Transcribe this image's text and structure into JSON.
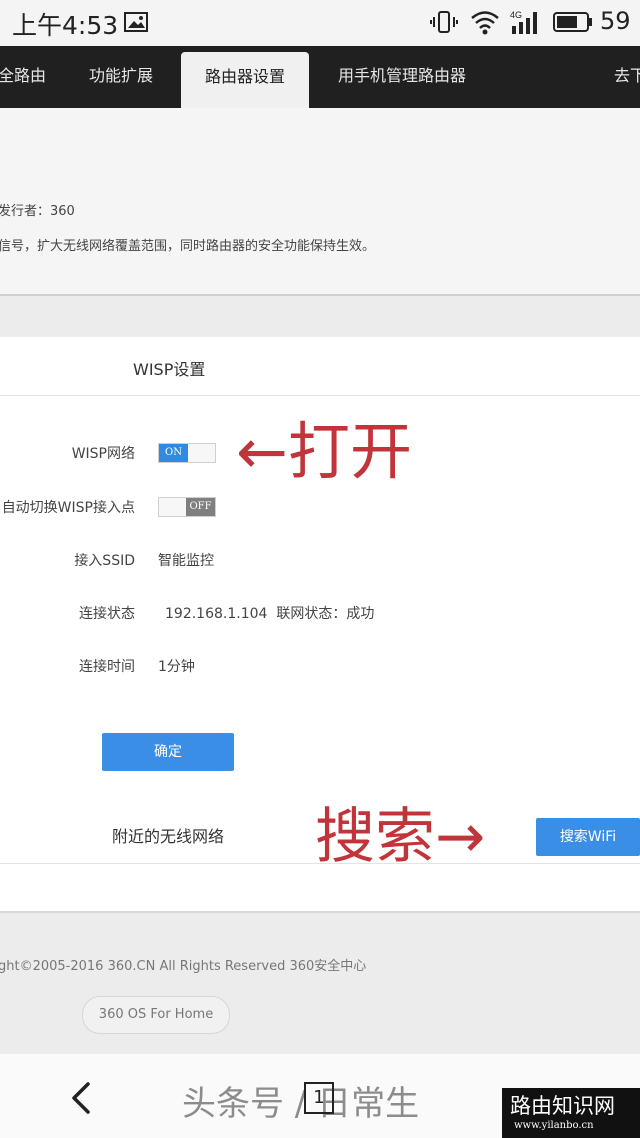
{
  "status_bar": {
    "time": "上午4:53",
    "battery": "59",
    "icons": [
      "image-icon",
      "vibrate-icon",
      "wifi-icon",
      "4g-signal-icon",
      "battery-icon"
    ]
  },
  "tabs": [
    {
      "label": "全路由"
    },
    {
      "label": "功能扩展"
    },
    {
      "label": "路由器设置",
      "active": true
    },
    {
      "label": "用手机管理路由器"
    },
    {
      "label": "去下"
    }
  ],
  "info": {
    "publisher": "发行者：360",
    "description": "信号，扩大无线网络覆盖范围，同时路由器的安全功能保持生效。"
  },
  "panel": {
    "title": "WISP设置",
    "rows": [
      {
        "label": "WISP网络",
        "toggle": "ON"
      },
      {
        "label": "自动切换WISP接入点",
        "toggle": "OFF"
      },
      {
        "label": "接入SSID",
        "value": "智能监控"
      },
      {
        "label": "连接状态",
        "value": "192.168.1.104  联网状态：成功"
      },
      {
        "label": "连接时间",
        "value": "1分钟"
      }
    ],
    "confirm_button": "确定",
    "nearby_title": "附近的无线网络",
    "search_button": "搜索WiFi"
  },
  "annotations": {
    "open": "←打开",
    "search": "搜索→"
  },
  "footer": {
    "copyright": "ght©2005-2016 360.CN All Rights Reserved 360安全中心",
    "os_label": "360 OS For Home"
  },
  "bottom_bar": {
    "watermark": "头条号 / 日常生",
    "badge_title": "路由知识网",
    "badge_url": "www.yilanbo.cn"
  },
  "colors": {
    "accent": "#3a8ee6",
    "annotation": "#c0343a",
    "nav_bg": "#202020"
  }
}
